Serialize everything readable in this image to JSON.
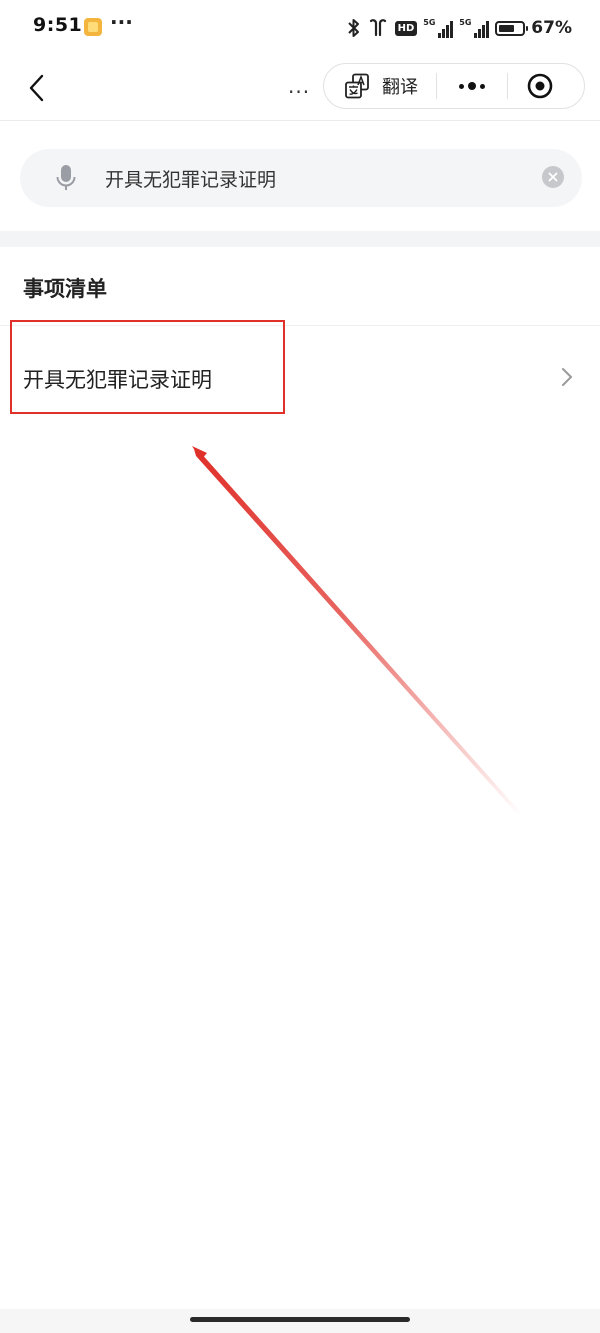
{
  "status_bar": {
    "time": "9:51",
    "overflow_dots": "···",
    "network_tag_1": "5G",
    "network_tag_2": "5G",
    "hd_label": "HD",
    "battery_percent": "67%",
    "battery_level": 0.67
  },
  "nav": {
    "back_icon": "chevron-left-icon",
    "more_text": "...",
    "capsule": {
      "translate_icon": "translate-icon",
      "translate_label": "翻译",
      "menu_icon": "more-dots-icon",
      "close_icon": "target-close-icon"
    }
  },
  "search": {
    "mic_icon": "microphone-icon",
    "value": "开具无犯罪记录证明",
    "clear_icon": "clear-icon"
  },
  "section": {
    "title": "事项清单",
    "items": [
      {
        "label": "开具无犯罪记录证明",
        "chevron_icon": "chevron-right-icon"
      }
    ]
  },
  "colors": {
    "annotation_red": "#e0302a",
    "search_bg": "#f4f5f7",
    "divider": "#efefef"
  }
}
